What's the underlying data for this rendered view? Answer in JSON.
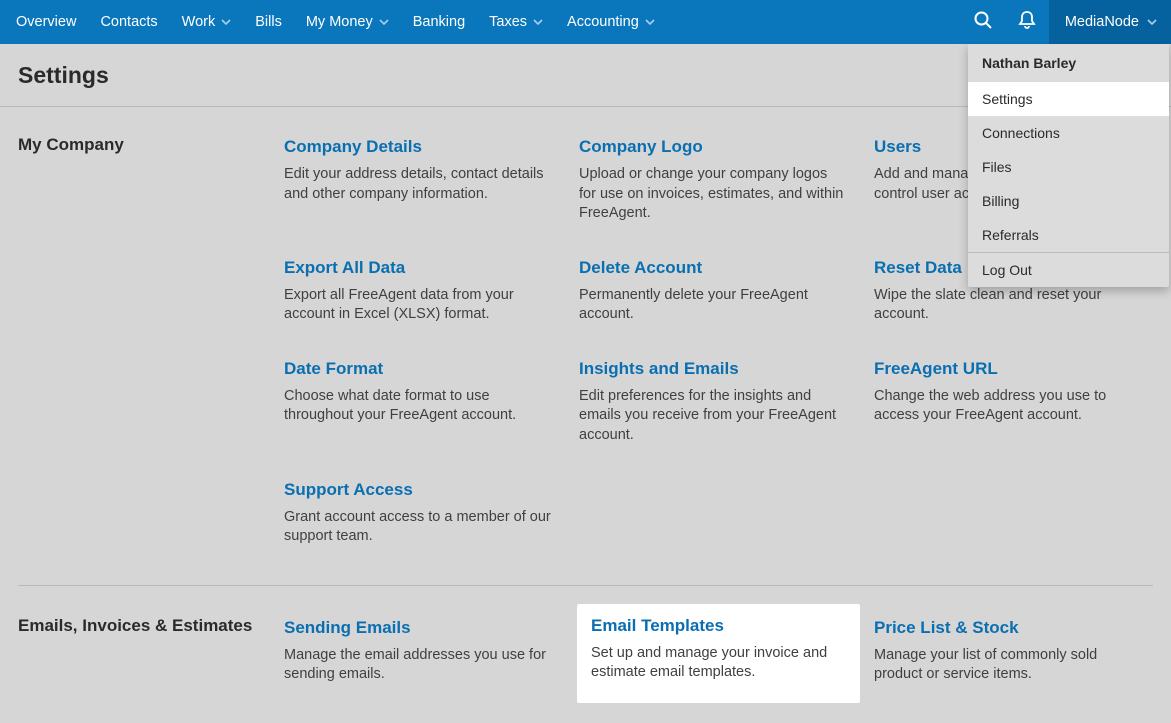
{
  "nav": {
    "items": [
      {
        "label": "Overview",
        "hasChevron": false
      },
      {
        "label": "Contacts",
        "hasChevron": false
      },
      {
        "label": "Work",
        "hasChevron": true
      },
      {
        "label": "Bills",
        "hasChevron": false
      },
      {
        "label": "My Money",
        "hasChevron": true
      },
      {
        "label": "Banking",
        "hasChevron": false
      },
      {
        "label": "Taxes",
        "hasChevron": true
      },
      {
        "label": "Accounting",
        "hasChevron": true
      }
    ],
    "company": "MediaNode"
  },
  "dropdown": {
    "user": "Nathan Barley",
    "items": [
      "Settings",
      "Connections",
      "Files",
      "Billing",
      "Referrals"
    ],
    "logout": "Log Out"
  },
  "page": {
    "title": "Settings"
  },
  "sections": [
    {
      "heading": "My Company",
      "tiles": [
        {
          "title": "Company Details",
          "desc": "Edit your address details, contact details and other company information."
        },
        {
          "title": "Company Logo",
          "desc": "Upload or change your company logos for use on invoices, estimates, and within FreeAgent."
        },
        {
          "title": "Users",
          "desc": "Add and manage additional users, and control user access levels."
        },
        {
          "title": "Export All Data",
          "desc": "Export all FreeAgent data from your account in Excel (XLSX) format."
        },
        {
          "title": "Delete Account",
          "desc": "Permanently delete your FreeAgent account."
        },
        {
          "title": "Reset Data",
          "desc": "Wipe the slate clean and reset your account."
        },
        {
          "title": "Date Format",
          "desc": "Choose what date format to use throughout your FreeAgent account."
        },
        {
          "title": "Insights and Emails",
          "desc": "Edit preferences for the insights and emails you receive from your FreeAgent account."
        },
        {
          "title": "FreeAgent URL",
          "desc": "Change the web address you use to access your FreeAgent account."
        },
        {
          "title": "Support Access",
          "desc": "Grant account access to a member of our support team."
        }
      ]
    },
    {
      "heading": "Emails, Invoices & Estimates",
      "tiles": [
        {
          "title": "Sending Emails",
          "desc": "Manage the email addresses you use for sending emails."
        },
        {
          "title": "Email Templates",
          "desc": "Set up and manage your invoice and estimate email templates.",
          "highlight": true
        },
        {
          "title": "Price List & Stock",
          "desc": "Manage your list of commonly sold product or service items."
        }
      ]
    }
  ]
}
